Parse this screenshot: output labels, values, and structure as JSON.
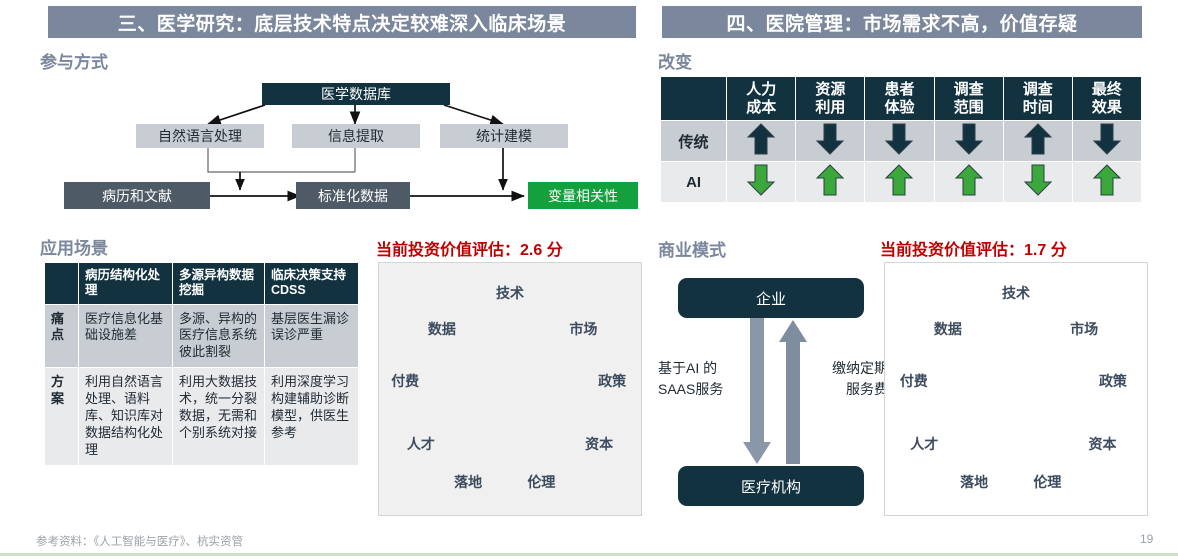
{
  "slide": {
    "page_number": "19",
    "footer_note": "参考资料：《人工智能与医疗》、杭实资管",
    "accent_dark": "#123240",
    "accent_slate": "#4e5a66",
    "accent_gray": "#c8cdd3",
    "accent_green": "#12a13c",
    "accent_red": "#c00000",
    "title_bar_bg": "#7b879c",
    "footer_rule_color": "#cfe0c4"
  },
  "left_panel": {
    "title": "三、医学研究：底层技术特点决定较难深入临床场景",
    "flow_heading": "参与方式",
    "flow": {
      "top": "医学数据库",
      "mid": [
        "自然语言处理",
        "信息提取",
        "统计建模"
      ],
      "bottom": [
        "病历和文献",
        "标准化数据",
        "变量相关性"
      ]
    },
    "table_heading": "应用场景",
    "table": {
      "headers": [
        "",
        "病历结构化处理",
        "多源异构数据挖掘",
        "临床决策支持CDSS"
      ],
      "rows": [
        {
          "label": "痛点",
          "cells": [
            "医疗信息化基础设施差",
            "多源、异构的医疗信息系统彼此割裂",
            "基层医生漏诊误诊严重"
          ]
        },
        {
          "label": "方案",
          "cells": [
            "利用自然语言处理、语料库、知识库对数据结构化处理",
            "利用大数据技术，统一分裂数据，无需和个别系统对接",
            "利用深度学习构建辅助诊断模型，供医生参考"
          ]
        }
      ]
    },
    "score_label": "当前投资价值评估：2.6 分",
    "octagon": {
      "background": "#f0f0f0",
      "nodes": [
        "技术",
        "市场",
        "政策",
        "资本",
        "伦理",
        "落地",
        "人才",
        "付费",
        "数据"
      ]
    }
  },
  "right_panel": {
    "title": "四、医院管理：市场需求不高，价值存疑",
    "table_heading": "改变",
    "table": {
      "headers": [
        "",
        "人力成本",
        "资源利用",
        "患者体验",
        "调查范围",
        "调查时间",
        "最终效果"
      ],
      "header_lines": [
        [
          "",
          ""
        ],
        [
          "人力",
          "成本"
        ],
        [
          "资源",
          "利用"
        ],
        [
          "患者",
          "体验"
        ],
        [
          "调查",
          "范围"
        ],
        [
          "调查",
          "时间"
        ],
        [
          "最终",
          "效果"
        ]
      ],
      "rows": [
        {
          "label": "传统",
          "arrows": [
            "up",
            "down",
            "down",
            "down",
            "up",
            "down"
          ],
          "arrow_color": "#123240"
        },
        {
          "label": "AI",
          "arrows": [
            "down",
            "up",
            "up",
            "up",
            "down",
            "up"
          ],
          "arrow_color": "#3aa83a"
        }
      ]
    },
    "bm_heading": "商业模式",
    "business_model": {
      "top_box": "企业",
      "bottom_box": "医疗机构",
      "left_label_line1": "基于AI 的",
      "left_label_line2": "SAAS服务",
      "right_label_line1": "缴纳定期",
      "right_label_line2": "服务费",
      "down_arrow_color": "#8a97a8",
      "up_arrow_color": "#7f8da0"
    },
    "score_label": "当前投资价值评估：1.7 分",
    "octagon": {
      "background": "#ffffff",
      "nodes": [
        "技术",
        "市场",
        "政策",
        "资本",
        "伦理",
        "落地",
        "人才",
        "付费",
        "数据"
      ]
    }
  }
}
